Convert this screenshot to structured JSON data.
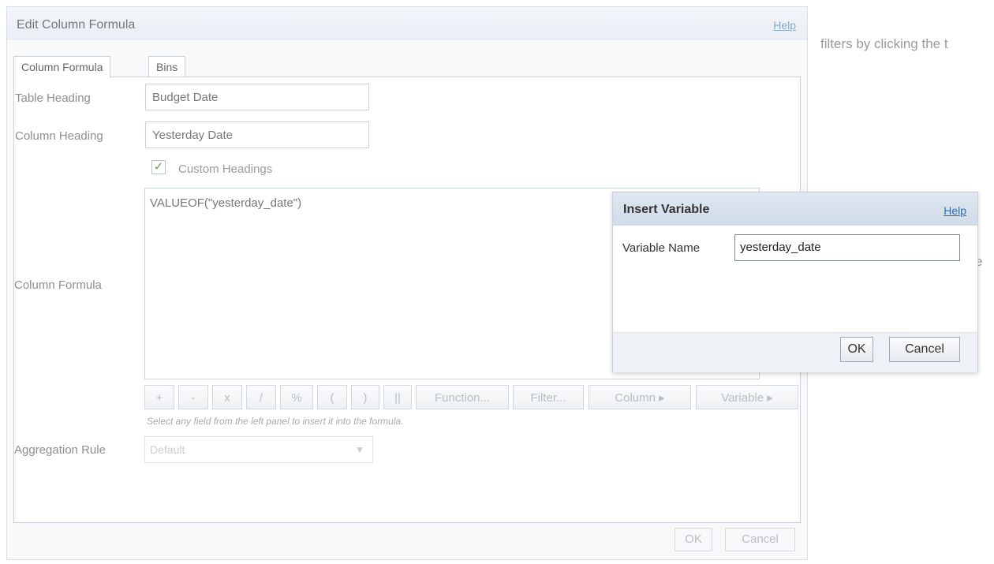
{
  "background": {
    "hint_text": "filters by clicking the t",
    "hint_fragment": "e"
  },
  "dialog": {
    "title": "Edit Column Formula",
    "help": "Help",
    "tabs": [
      "Column Formula",
      "Bins"
    ],
    "fields": {
      "table_heading_label": "Table Heading",
      "table_heading_value": "Budget Date",
      "column_heading_label": "Column Heading",
      "column_heading_value": "Yesterday Date",
      "custom_headings_label": "Custom Headings",
      "custom_headings_checked": true,
      "column_formula_label": "Column Formula",
      "column_formula_value": "VALUEOF(\"yesterday_date\")",
      "aggregation_label": "Aggregation Rule",
      "aggregation_value": "Default"
    },
    "toolbar": {
      "plus": "+",
      "minus": "-",
      "multiply": "x",
      "divide": "/",
      "percent": "%",
      "open_paren": "(",
      "close_paren": ")",
      "concat": "||",
      "function": "Function...",
      "filter": "Filter...",
      "column": "Column ▸",
      "variable": "Variable ▸"
    },
    "hint": "Select any field from the left panel to insert it into the formula.",
    "ok": "OK",
    "cancel": "Cancel"
  },
  "popup": {
    "title": "Insert Variable",
    "help": "Help",
    "variable_label": "Variable Name",
    "variable_value": "yesterday_date",
    "ok": "OK",
    "cancel": "Cancel"
  },
  "colors": {
    "popup_header": "#d6e1ed",
    "link": "#2c6bb3",
    "check": "#6e9a56"
  }
}
